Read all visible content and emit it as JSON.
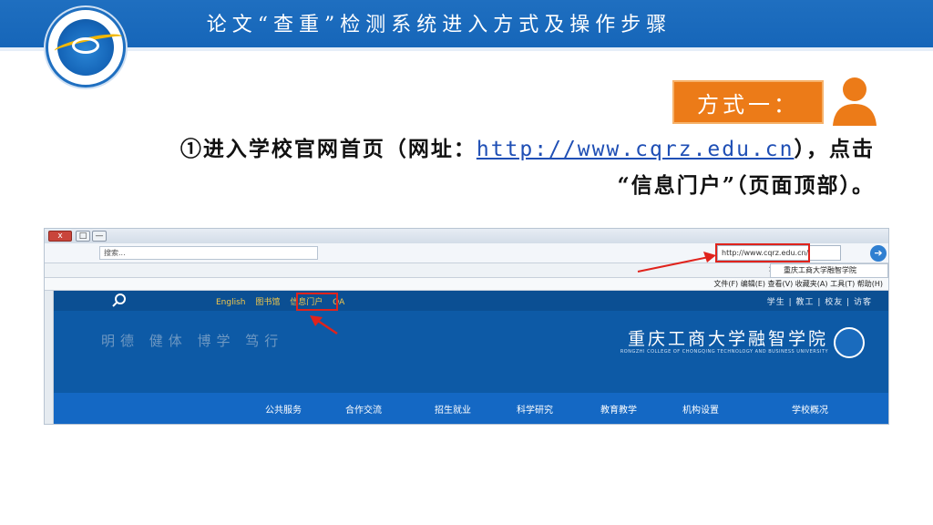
{
  "slide": {
    "title": "论文“查重”检测系统进入方式及操作步骤",
    "method_label": "方式一：",
    "instruction": {
      "prefix": "①进入学校官网首页（网址：",
      "url": "http://www.cqrz.edu.cn",
      "suffix": "），点击",
      "line2": "“信息门户”（页面顶部）。"
    }
  },
  "browser": {
    "window_buttons": [
      "x",
      "□",
      "—"
    ],
    "address": "http://www.cqrz.edu.cn/",
    "search_placeholder": "搜索...",
    "tab_title": "重庆工商大学融智学院",
    "menu": "文件(F)  编辑(E)  查看(V)  收藏夹(A)  工具(T)  帮助(H)"
  },
  "site": {
    "topnav_right": "学生 | 教工 | 校友 | 访客",
    "topnav_left": [
      "English",
      "图书馆",
      "信息门户",
      "OA"
    ],
    "slogan": "明德 健体 博学 笃行",
    "school_name": "重庆工商大学融智学院",
    "school_name_en": "RONGZHI COLLEGE OF CHONGQING TECHNOLOGY AND BUSINESS UNIVERSITY",
    "main_nav": [
      "学校概况",
      "机构设置",
      "教育教学",
      "科学研究",
      "招生就业",
      "合作交流",
      "公共服务"
    ]
  },
  "colors": {
    "title_bar": "#1565b8",
    "badge": "#ec7b18",
    "highlight": "#e0231c",
    "site_blue": "#0d5aa6"
  }
}
